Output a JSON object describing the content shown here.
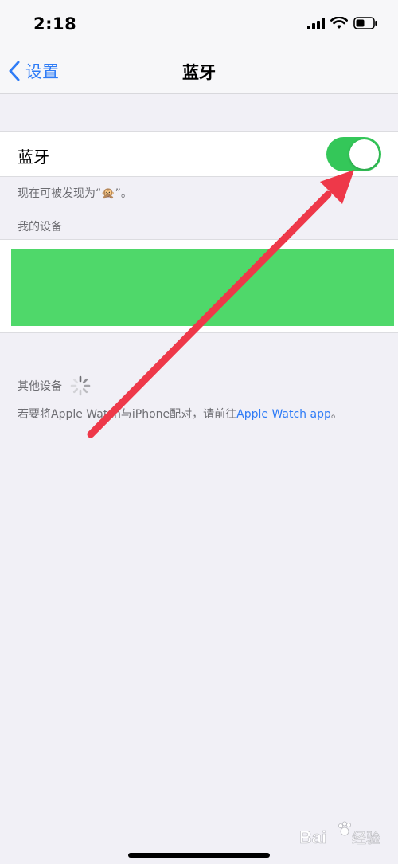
{
  "status_bar": {
    "time": "2:18"
  },
  "nav": {
    "back_label": "设置",
    "title": "蓝牙"
  },
  "bluetooth": {
    "label": "蓝牙",
    "enabled": true,
    "discoverable_note": "现在可被发现为“🙊”。"
  },
  "my_devices": {
    "header": "我的设备"
  },
  "other_devices": {
    "header": "其他设备",
    "note_prefix": "若要将Apple Watch与iPhone配对，请前往",
    "note_link": "Apple Watch app",
    "note_suffix": "。"
  },
  "watermark": {
    "text": "Bai 经验"
  },
  "colors": {
    "accent": "#2f7cf6",
    "toggle_on": "#34c759",
    "arrow": "#ee3849"
  },
  "icons": [
    "signal-icon",
    "wifi-icon",
    "battery-icon",
    "chevron-left-icon",
    "loading-spinner-icon"
  ]
}
